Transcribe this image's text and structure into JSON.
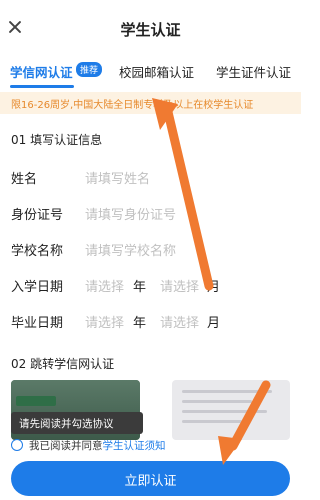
{
  "header": {
    "title": "学生认证",
    "close_icon": "close-icon"
  },
  "tabs": [
    {
      "label": "学信网认证",
      "badge": "推荐",
      "active": true
    },
    {
      "label": "校园邮箱认证"
    },
    {
      "label": "学生证件认证"
    }
  ],
  "notice": "限16-26周岁,中国大陆全日制专科及以上在校学生认证",
  "section1": {
    "title": "01 填写认证信息",
    "fields": [
      {
        "label": "姓名",
        "placeholder": "请填写姓名"
      },
      {
        "label": "身份证号",
        "placeholder": "请填写身份证号"
      },
      {
        "label": "学校名称",
        "placeholder": "请填写学校名称"
      }
    ],
    "dates": [
      {
        "label": "入学日期",
        "year_placeholder": "请选择",
        "year_unit": "年",
        "month_placeholder": "请选择",
        "month_unit": "月"
      },
      {
        "label": "毕业日期",
        "year_placeholder": "请选择",
        "year_unit": "年",
        "month_placeholder": "请选择",
        "month_unit": "月"
      }
    ]
  },
  "section2": {
    "title": "02 跳转学信网认证"
  },
  "tooltip": "请先阅读并勾选协议",
  "agreement": {
    "prefix": "我已阅读并同意",
    "link": "学生认证须知"
  },
  "submit_label": "立即认证",
  "colors": {
    "accent": "#1e7ce8",
    "notice_text": "#e6892c",
    "notice_bg": "#fdf2e2",
    "arrow": "#f07a31"
  }
}
